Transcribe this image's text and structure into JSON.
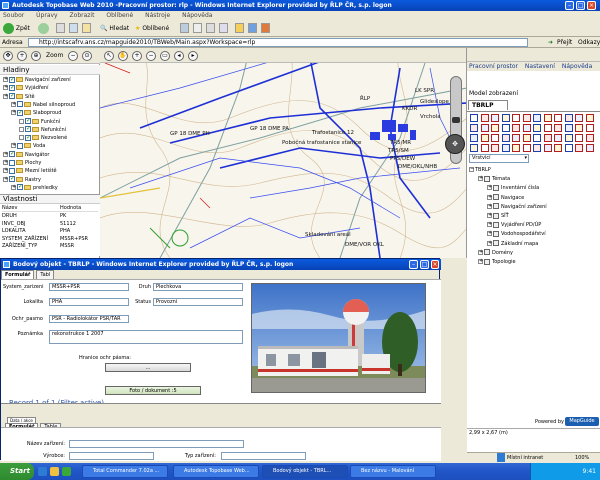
{
  "window": {
    "title": "Autodesk Topobase Web 2010 -Pracovní prostor: rlp - Windows Internet Explorer provided by ŘLP ČR, s.p. logon"
  },
  "browser": {
    "menu": [
      "Soubor",
      "Úpravy",
      "Zobrazit",
      "Oblíbené",
      "Nástroje",
      "Nápověda"
    ],
    "back_label": "Zpět",
    "search_label": "Hledat",
    "favorites_label": "Oblíbené",
    "address_label": "Adresa",
    "address_value": "http://intscafrv.ans.cz/mapguide2010/TBWeb/Main.aspx?Workspace=rlp",
    "go_label": "Přejít",
    "links_label": "Odkazy"
  },
  "left_panel": {
    "zoom_label": "Zoom",
    "layers_heading": "Hladiny",
    "layers": [
      {
        "label": "Navigační zařízení",
        "depth": 0,
        "checked": true
      },
      {
        "label": "Vyjádření",
        "depth": 0,
        "checked": true
      },
      {
        "label": "Sítě",
        "depth": 0,
        "checked": true
      },
      {
        "label": "Nabel silnoproud",
        "depth": 1,
        "checked": false
      },
      {
        "label": "Slaboproud",
        "depth": 1,
        "checked": true
      },
      {
        "label": "Funkční",
        "depth": 2,
        "checked": true
      },
      {
        "label": "Nefunkční",
        "depth": 2,
        "checked": true
      },
      {
        "label": "Nezvolené",
        "depth": 2,
        "checked": true
      },
      {
        "label": "Voda",
        "depth": 1,
        "checked": false
      },
      {
        "label": "Navigátor",
        "depth": 0,
        "checked": true
      },
      {
        "label": "Plochy",
        "depth": 0,
        "checked": false
      },
      {
        "label": "Mezní letiště",
        "depth": 0,
        "checked": false
      },
      {
        "label": "Rastry",
        "depth": 0,
        "checked": true
      },
      {
        "label": "prehledky",
        "depth": 1,
        "checked": true
      }
    ],
    "properties_heading": "Vlastnosti",
    "properties_columns": [
      "Název",
      "Hodnota"
    ],
    "properties": [
      {
        "name": "DRUH",
        "value": "PK"
      },
      {
        "name": "INVC_OBJ",
        "value": "51112"
      },
      {
        "name": "LOKALITA",
        "value": "PHA"
      },
      {
        "name": "SYSTEM_ZAŘÍZENÍ",
        "value": "MSSR+PSR"
      },
      {
        "name": "ZAŘÍZENÍ_TYP",
        "value": "MSSR"
      }
    ]
  },
  "map": {
    "labels": [
      "GP 18 DME PH",
      "GP 18 DME PA",
      "Trafostanice 12",
      "Pobočná trafostanice stanice",
      "Skladování areál",
      "DME/VOR OKL",
      "ŘLP",
      "LK SPR",
      "TR5/MR",
      "TR5/SM",
      "Glideslope",
      "KKDR",
      "PPS/DEW",
      "DME/OKL/NHB",
      "Vrchola"
    ]
  },
  "right_panel": {
    "menu": [
      "Pracovní prostor",
      "Nastavení",
      "Nápověda"
    ],
    "model_label": "Model zobrazení",
    "tab_label": "TBRLP",
    "select_value": "Vrstvicí",
    "tree_root": "TBRLP",
    "tree": [
      {
        "label": "Témata",
        "depth": 1
      },
      {
        "label": "Inventární čísla",
        "depth": 2
      },
      {
        "label": "Navigace",
        "depth": 2
      },
      {
        "label": "Navigační zařízení",
        "depth": 2
      },
      {
        "label": "SÍŤ",
        "depth": 2
      },
      {
        "label": "Vyjádření PD/ÚP",
        "depth": 2
      },
      {
        "label": "Vodohospodářství",
        "depth": 2
      },
      {
        "label": "Základní mapa",
        "depth": 2
      },
      {
        "label": "Domény",
        "depth": 1
      },
      {
        "label": "Topologie",
        "depth": 1
      }
    ],
    "coords": "2,99 x 2,67 (m)",
    "powered_by": "Powered by",
    "brand": "MapGuide"
  },
  "popup": {
    "title": "Bodový objekt - TBRLP - Windows Internet Explorer provided by ŘLP ČR, s.p. logon",
    "tabs": [
      "Formulář",
      "Tabl"
    ],
    "fields": {
      "system_label": "System_zarizeni",
      "system_value": "MSSR+PSR",
      "druh_label": "Druh",
      "druh_value": "Plechkova",
      "lokalita_label": "Lokalita",
      "lokalita_value": "PHA",
      "status_label": "Status",
      "status_value": "Provozní",
      "ochr_label": "Ochr_pasmo",
      "ochr_value": "PSR - Radiolokátor PSR/TAR",
      "poznamka_label": "Poznámka",
      "poznamka_value": "rekonstrukce 1 2007",
      "hranice_label": "Hranice ochr pásma:",
      "hranice_button": "...",
      "foto_button": "Foto / dokument :5"
    },
    "record_text": "Record 1 of 1 (Filter active)",
    "lower_tabs_top": [
      "Data / akce"
    ],
    "lower_tabs": [
      "Formulář",
      "Table"
    ],
    "lower_fields": {
      "nazev_label": "Název zařízení:",
      "vyrobce_label": "Výrobce:",
      "typ_label": "Typ zařízení:"
    }
  },
  "ie_status": {
    "zone": "Místní intranet",
    "percent": "100%"
  },
  "taskbar": {
    "start": "Start",
    "tasks": [
      "Total Commander 7.02a ...",
      "Autodesk Topobase Web...",
      "Bodový objekt - TBRL...",
      "Bez názvu - Malování"
    ],
    "active_task": 2,
    "clock": "9:41"
  }
}
